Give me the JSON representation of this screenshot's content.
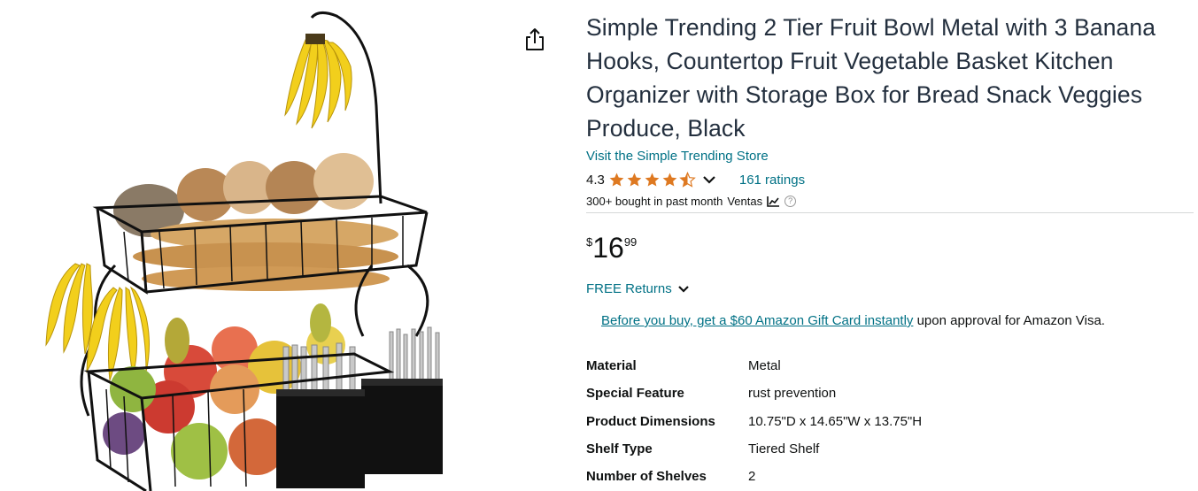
{
  "product": {
    "title": "Simple Trending 2 Tier Fruit Bowl Metal with 3 Banana Hooks, Countertop Fruit Vegetable Basket Kitchen Organizer with Storage Box for Bread Snack Veggies Produce, Black",
    "store_link": "Visit the Simple Trending Store",
    "rating": "4.3",
    "ratings_count": "161 ratings",
    "bought_text": "300+ bought in past month",
    "ventas_label": "Ventas",
    "help_glyph": "?",
    "star_color": "#de7921"
  },
  "price": {
    "symbol": "$",
    "whole": "16",
    "fraction": "99"
  },
  "returns": {
    "label": "FREE Returns"
  },
  "promo": {
    "link_text": "Before you buy, get a $60 Amazon Gift Card instantly",
    "rest_text": " upon approval for Amazon Visa."
  },
  "specs": [
    {
      "key": "Material",
      "value": "Metal"
    },
    {
      "key": "Special Feature",
      "value": "rust prevention"
    },
    {
      "key": "Product Dimensions",
      "value": "10.75\"D x 14.65\"W x 13.75\"H"
    },
    {
      "key": "Shelf Type",
      "value": "Tiered Shelf"
    },
    {
      "key": "Number of Shelves",
      "value": "2"
    }
  ]
}
